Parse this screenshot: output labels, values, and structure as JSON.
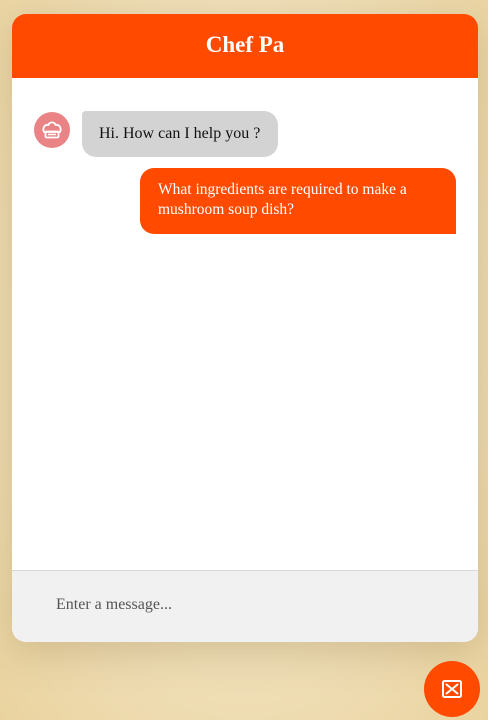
{
  "header": {
    "title": "Chef Pa"
  },
  "messages": [
    {
      "direction": "incoming",
      "text": "Hi. How can I help you ?"
    },
    {
      "direction": "outgoing",
      "text": "What ingredients are required to make a mushroom soup dish?"
    }
  ],
  "composer": {
    "placeholder": "Enter a message..."
  },
  "icons": {
    "avatar": "chef-hat-icon",
    "toggle": "close-chat-icon"
  },
  "colors": {
    "accent": "#ff4a00",
    "avatar_bg": "#e98385",
    "incoming_bubble": "#d3d3d3",
    "input_bar": "#f1f1f1"
  }
}
